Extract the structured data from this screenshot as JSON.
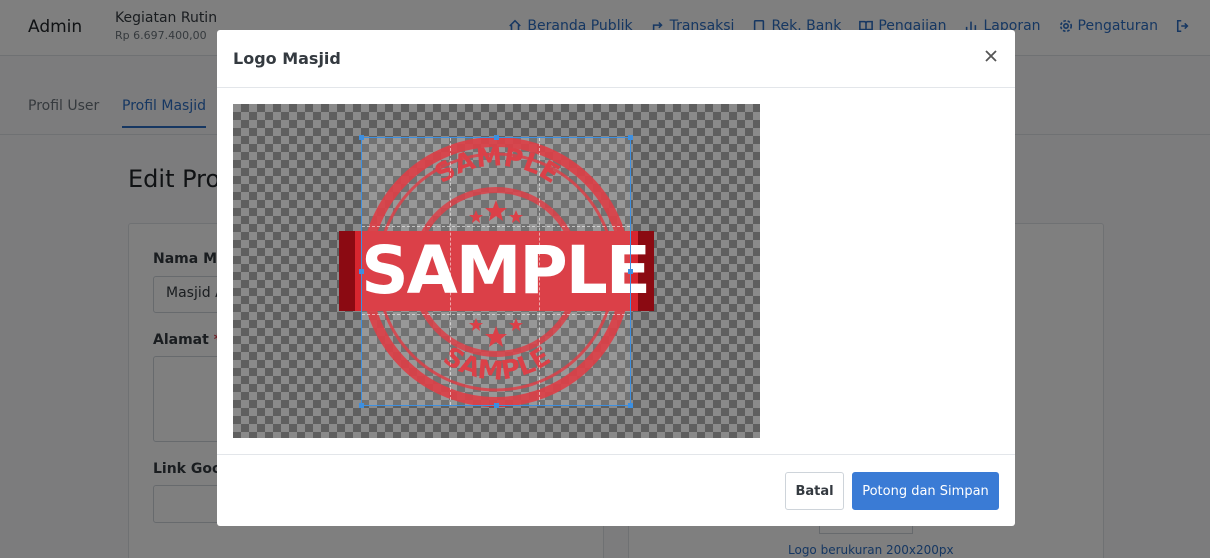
{
  "topbar": {
    "brand": "Admin",
    "org_name": "Kegiatan Rutin",
    "org_balance": "Rp 6.697.400,00",
    "nav": [
      {
        "label": "Beranda Publik",
        "icon": "home-icon"
      },
      {
        "label": "Transaksi",
        "icon": "share-icon"
      },
      {
        "label": "Rek. Bank",
        "icon": "book-icon"
      },
      {
        "label": "Pengajian",
        "icon": "open-book-icon"
      },
      {
        "label": "Laporan",
        "icon": "chart-icon"
      },
      {
        "label": "Pengaturan",
        "icon": "gear-icon"
      }
    ],
    "logout_icon": "logout-icon"
  },
  "tabs": [
    {
      "label": "Profil User",
      "active": false
    },
    {
      "label": "Profil Masjid",
      "active": true
    }
  ],
  "page": {
    "title": "Edit Prof",
    "fields": {
      "name_label": "Nama Mas",
      "name_value": "Masjid A",
      "address_label": "Alamat",
      "address_required": "*",
      "gmaps_label": "Link Goog"
    },
    "logo_note": "Logo berukuran 200x200px"
  },
  "modal": {
    "title": "Logo Masjid",
    "close_icon": "close-icon",
    "image": {
      "stamp_text": "SAMPLE",
      "arc_text": "SAMPLE",
      "stamp_color": "#d7262f"
    },
    "cancel_label": "Batal",
    "save_label": "Potong dan Simpan",
    "accent": "#3a7bd5"
  }
}
